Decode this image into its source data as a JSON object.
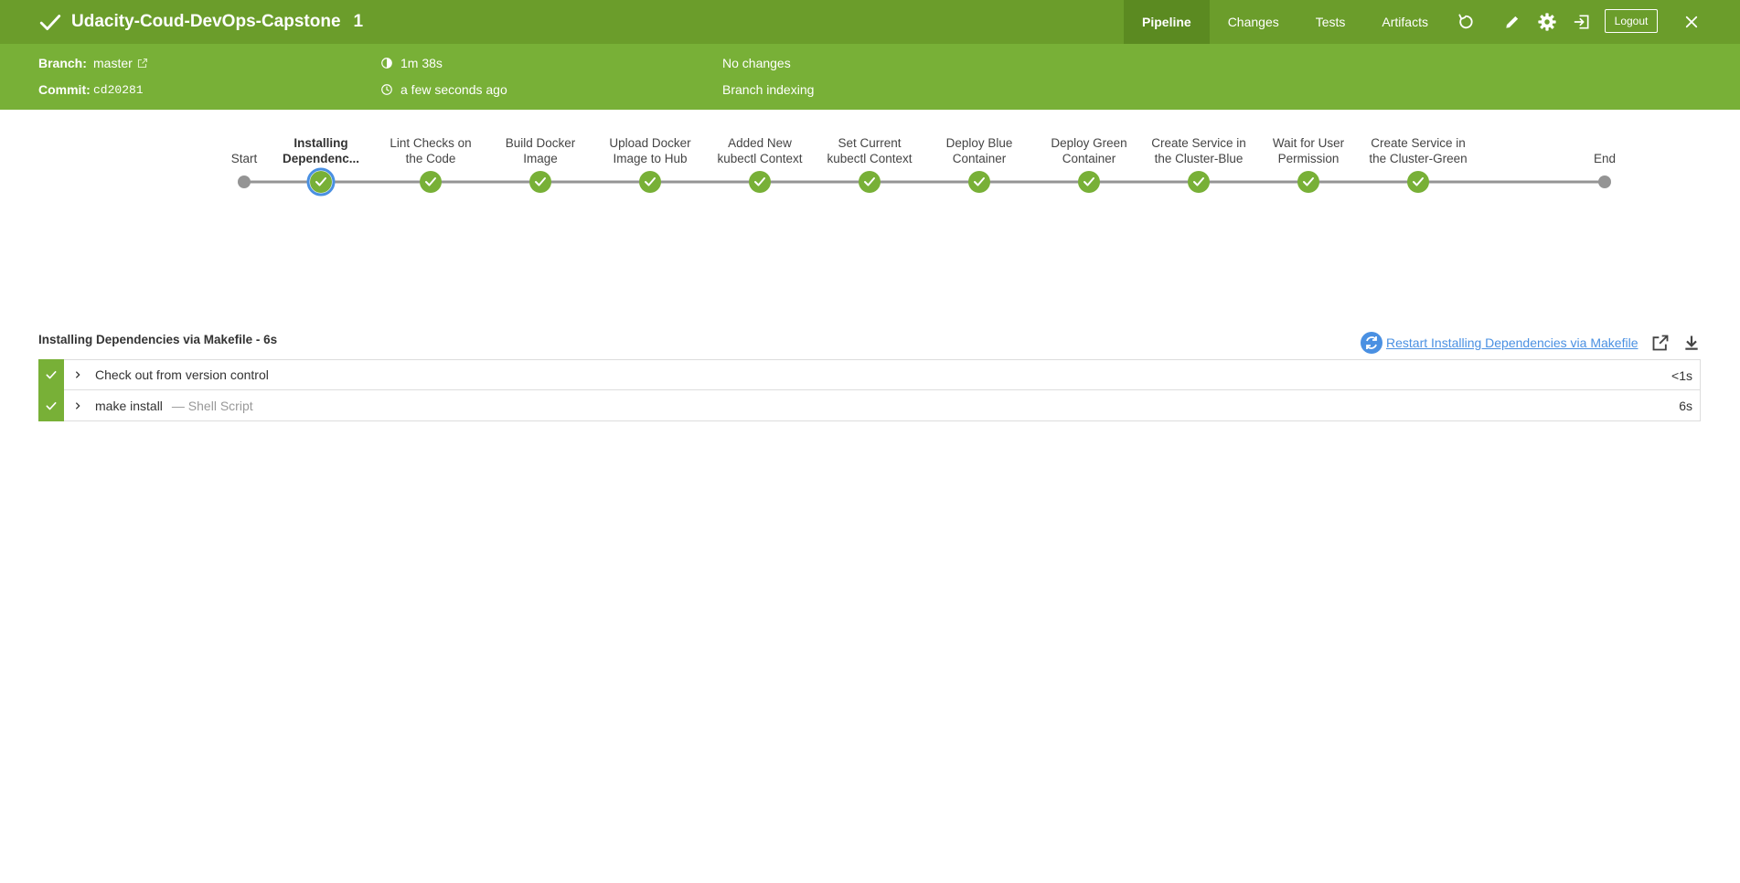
{
  "header": {
    "title": "Udacity-Coud-DevOps-Capstone",
    "run_number": "1",
    "tabs": [
      {
        "label": "Pipeline",
        "active": true
      },
      {
        "label": "Changes",
        "active": false
      },
      {
        "label": "Tests",
        "active": false
      },
      {
        "label": "Artifacts",
        "active": false
      }
    ],
    "icons": [
      "replay-icon",
      "edit-icon",
      "gear-icon",
      "exit-icon",
      "close-icon"
    ],
    "logout_label": "Logout"
  },
  "meta": {
    "branch_label": "Branch:",
    "branch": "master",
    "commit_label": "Commit:",
    "commit": "cd20281",
    "duration": "1m 38s",
    "started": "a few seconds ago",
    "changes": "No changes",
    "cause": "Branch indexing"
  },
  "pipeline": {
    "stages": [
      {
        "label": "Start",
        "status": "start"
      },
      {
        "label": "Installing Dependenc...",
        "status": "success",
        "selected": true
      },
      {
        "label": "Lint Checks on the Code",
        "status": "success"
      },
      {
        "label": "Build Docker Image",
        "status": "success"
      },
      {
        "label": "Upload Docker Image to Hub",
        "status": "success"
      },
      {
        "label": "Added New kubectl Context",
        "status": "success"
      },
      {
        "label": "Set Current kubectl Context",
        "status": "success"
      },
      {
        "label": "Deploy Blue Container",
        "status": "success"
      },
      {
        "label": "Deploy Green Container",
        "status": "success"
      },
      {
        "label": "Create Service in the Cluster-Blue",
        "status": "success"
      },
      {
        "label": "Wait for User Permission",
        "status": "success"
      },
      {
        "label": "Create Service in the Cluster-Green",
        "status": "success"
      },
      {
        "label": "End",
        "status": "end"
      }
    ]
  },
  "steps_panel": {
    "title": "Installing Dependencies via Makefile - 6s",
    "restart_label": "Restart Installing Dependencies via Makefile",
    "steps": [
      {
        "name": "Check out from version control",
        "sub": "",
        "duration": "<1s",
        "status": "success"
      },
      {
        "name": "make install",
        "sub": "— Shell Script",
        "duration": "6s",
        "status": "success"
      }
    ]
  },
  "colors": {
    "header_bg": "#6b9d2b",
    "subheader_bg": "#78b037",
    "success": "#78b037",
    "selected_ring": "#4a90e2",
    "link": "#4a90e2"
  }
}
